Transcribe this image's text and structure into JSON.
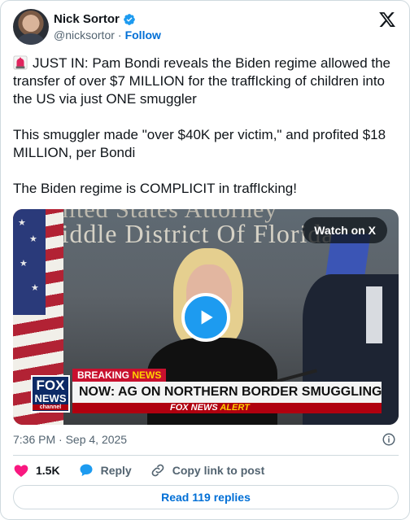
{
  "author": {
    "name": "Nick Sortor",
    "handle": "@nicksortor",
    "separator": "·",
    "follow_label": "Follow"
  },
  "tweet": {
    "text": "JUST IN: Pam Bondi reveals the Biden regime allowed the transfer of over $7 MILLION for the traffIcking of children into the US via just ONE smuggler\n\nThis smuggler made \"over $40K per victim,\" and profited $18 MILLION, per Bondi\n\nThe Biden regime is COMPLICIT in traffIcking!",
    "emoji_icon": "siren-icon"
  },
  "media": {
    "watch_label": "Watch on X",
    "wall_text_top": "United States Attorney",
    "wall_text": "Middle District Of Florida",
    "fox_logo": {
      "line1": "FOX",
      "line2": "NEWS",
      "line3": "channel"
    },
    "breaking_label": "BREAKING",
    "breaking_news": "NEWS",
    "headline": "NOW: AG ON NORTHERN BORDER SMUGGLING CRACKDOWN",
    "alert_prefix": "FOX NEWS",
    "alert_word": "ALERT"
  },
  "footer": {
    "timestamp": "7:36 PM · Sep 4, 2025",
    "likes_count": "1.5K",
    "reply_label": "Reply",
    "copy_link_label": "Copy link to post",
    "read_replies_label": "Read 119 replies"
  },
  "colors": {
    "accent": "#1d9bf0",
    "link": "#006fd6",
    "like": "#f91880",
    "muted": "#536471",
    "fox_red": "#c8102e"
  }
}
